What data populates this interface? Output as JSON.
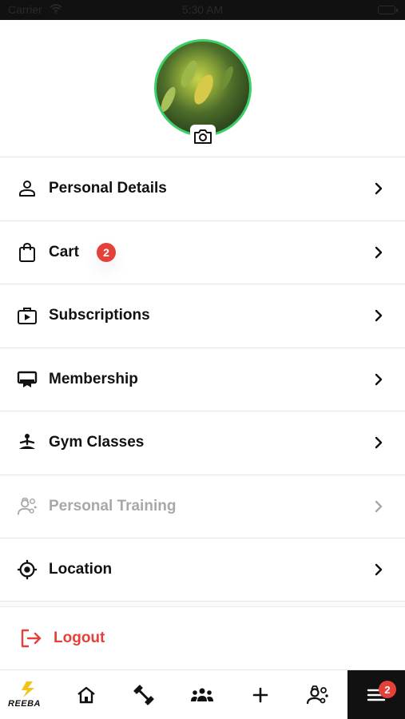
{
  "status_bar": {
    "carrier": "Carrier",
    "time": "5:30 AM"
  },
  "profile": {
    "avatar_alt": "Profile photo",
    "camera_icon": "camera-icon"
  },
  "menu": [
    {
      "key": "personal-details",
      "label": "Personal Details",
      "icon": "person-icon",
      "enabled": true
    },
    {
      "key": "cart",
      "label": "Cart",
      "icon": "shopping-bag-icon",
      "badge": "2",
      "enabled": true
    },
    {
      "key": "subscriptions",
      "label": "Subscriptions",
      "icon": "play-bag-icon",
      "enabled": true
    },
    {
      "key": "membership",
      "label": "Membership",
      "icon": "membership-card-icon",
      "enabled": true
    },
    {
      "key": "gym-classes",
      "label": "Gym Classes",
      "icon": "yoga-icon",
      "enabled": true
    },
    {
      "key": "personal-training",
      "label": "Personal Training",
      "icon": "trainer-icon",
      "enabled": false
    },
    {
      "key": "location",
      "label": "Location",
      "icon": "location-target-icon",
      "enabled": true
    }
  ],
  "logout": {
    "label": "Logout",
    "icon": "logout-icon"
  },
  "tabbar": {
    "logo_text": "REEBA",
    "tabs": [
      "logo",
      "home-icon",
      "dumbbell-icon",
      "group-icon",
      "plus-icon",
      "trainer-icon",
      "menu-icon"
    ],
    "menu_badge": "2"
  },
  "colors": {
    "accent_red": "#e5413b",
    "avatar_ring": "#3ccf6a",
    "disabled_text": "#a8a8a8",
    "active_tab": "#111111"
  }
}
